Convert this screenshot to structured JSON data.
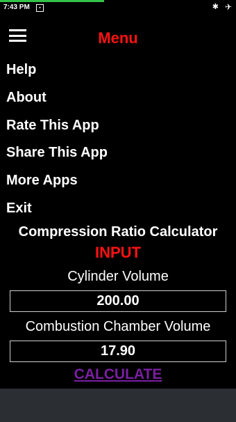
{
  "status_bar": {
    "time": "7:43 PM",
    "progress_fraction": 0.44,
    "icons": [
      "notification-icon",
      "bluetooth-icon",
      "airplane-icon"
    ]
  },
  "menu": {
    "title": "Menu",
    "items": [
      "Help",
      "About",
      "Rate This App",
      "Share This App",
      "More Apps",
      "Exit"
    ]
  },
  "calculator": {
    "title": "Compression Ratio Calculator",
    "section_label": "INPUT",
    "cylinder_volume_label": "Cylinder Volume",
    "cylinder_volume_value": "200.00",
    "combustion_chamber_label": "Combustion Chamber Volume",
    "combustion_chamber_value": "17.90",
    "calculate_label": "CALCULATE"
  },
  "colors": {
    "accent_red": "#ff1212",
    "calculate_purple": "#7a1fa2",
    "progress_green": "#34c34a"
  }
}
